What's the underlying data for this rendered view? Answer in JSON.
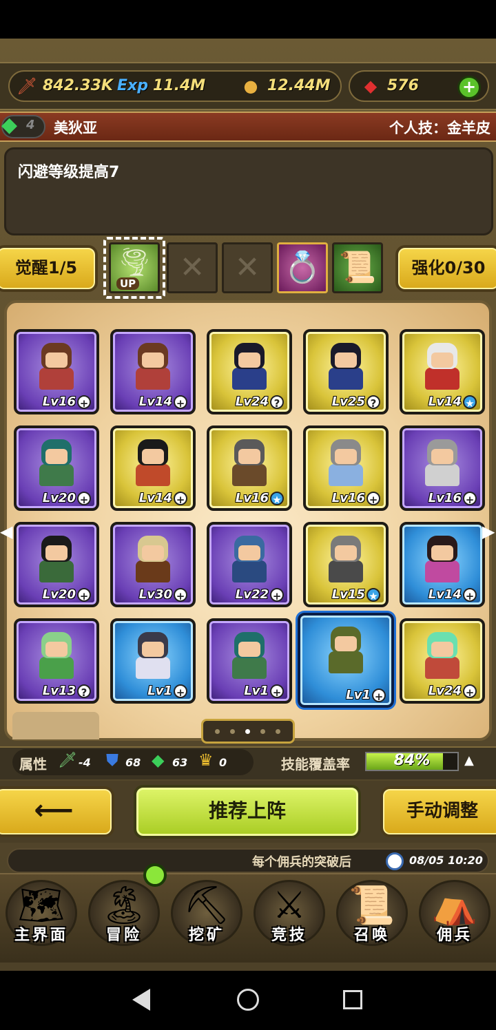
{
  "resources": {
    "attack": "842.33K",
    "exp_label": "Exp",
    "exp": "11.4M",
    "gold": "12.44M",
    "gems": "576",
    "add_label": "+"
  },
  "hero": {
    "level": "4",
    "name": "美狄亚",
    "skill_label": "个人技：金羊皮",
    "description": "闪避等级提高7"
  },
  "awaken": {
    "button": "觉醒1/5",
    "up_label": "UP",
    "enhance_button": "强化0/30"
  },
  "heroes": [
    {
      "level": "Lv16",
      "badge": "+",
      "color": "purple",
      "hair": "#6b3a22",
      "outfit": "#b0403a"
    },
    {
      "level": "Lv14",
      "badge": "+",
      "color": "purple",
      "hair": "#6b3a22",
      "outfit": "#b0403a"
    },
    {
      "level": "Lv24",
      "badge": "?",
      "color": "gold",
      "hair": "#1a1a2a",
      "outfit": "#2a3f8a"
    },
    {
      "level": "Lv25",
      "badge": "?",
      "color": "gold",
      "hair": "#1a1a2a",
      "outfit": "#2a3f8a"
    },
    {
      "level": "Lv14",
      "badge": "★",
      "color": "gold",
      "hair": "#e8e8e8",
      "outfit": "#c0302a"
    },
    {
      "level": "Lv20",
      "badge": "+",
      "color": "purple",
      "hair": "#1f6f6a",
      "outfit": "#3f7a4a"
    },
    {
      "level": "Lv14",
      "badge": "+",
      "color": "gold",
      "hair": "#1a1a1a",
      "outfit": "#c04a2a"
    },
    {
      "level": "Lv16",
      "badge": "★",
      "color": "gold",
      "hair": "#5a5a5a",
      "outfit": "#6a4a2a"
    },
    {
      "level": "Lv16",
      "badge": "+",
      "color": "gold",
      "hair": "#8a8a8a",
      "outfit": "#8ab0e0"
    },
    {
      "level": "Lv16",
      "badge": "+",
      "color": "purple",
      "hair": "#9a9a9a",
      "outfit": "#d0d0d0"
    },
    {
      "level": "Lv20",
      "badge": "+",
      "color": "purple",
      "hair": "#1a1a1a",
      "outfit": "#3a6a3a"
    },
    {
      "level": "Lv30",
      "badge": "+",
      "color": "purple",
      "hair": "#d8c890",
      "outfit": "#6a3a1a"
    },
    {
      "level": "Lv22",
      "badge": "+",
      "color": "purple",
      "hair": "#3a6aa0",
      "outfit": "#2a4a80"
    },
    {
      "level": "Lv15",
      "badge": "★",
      "color": "gold",
      "hair": "#7a7a7a",
      "outfit": "#4a4a4a"
    },
    {
      "level": "Lv14",
      "badge": "+",
      "color": "blue",
      "hair": "#2a1a1a",
      "outfit": "#c04aa0"
    },
    {
      "level": "Lv13",
      "badge": "?",
      "color": "purple",
      "hair": "#8ad08a",
      "outfit": "#4aa04a"
    },
    {
      "level": "Lv1",
      "badge": "+",
      "color": "blue",
      "hair": "#3a3a4a",
      "outfit": "#e0e0f0"
    },
    {
      "level": "Lv1",
      "badge": "+",
      "color": "purple",
      "hair": "#1f6f6a",
      "outfit": "#3f7a4a"
    },
    {
      "level": "Lv1",
      "badge": "+",
      "color": "blue",
      "hair": "#5a6a2a",
      "outfit": "#5a6a2a",
      "selected": true
    },
    {
      "level": "Lv24",
      "badge": "+",
      "color": "gold",
      "hair": "#6ae0b0",
      "outfit": "#c04a3a"
    }
  ],
  "attributes": {
    "label": "属性",
    "attack": "-4",
    "defense": "68",
    "emerald": "63",
    "crown": "0",
    "coverage_label": "技能覆盖率",
    "coverage": "84%",
    "coverage_fraction": 0.84
  },
  "buttons": {
    "recommend": "推荐上阵",
    "manual": "手动调整"
  },
  "ticker": {
    "text": "每个佣兵的突破后",
    "time": "08/05 10:20"
  },
  "menu": [
    {
      "label": "主界面",
      "icon": "map-scroll-icon",
      "glyph": "🗺"
    },
    {
      "label": "冒险",
      "icon": "island-icon",
      "glyph": "🏝"
    },
    {
      "label": "挖矿",
      "icon": "pickaxe-icon",
      "glyph": "⛏"
    },
    {
      "label": "竞技",
      "icon": "crossed-swords-icon",
      "glyph": "⚔"
    },
    {
      "label": "召唤",
      "icon": "summon-scroll-icon",
      "glyph": "📜"
    },
    {
      "label": "佣兵",
      "icon": "tent-icon",
      "glyph": "⛺"
    }
  ]
}
